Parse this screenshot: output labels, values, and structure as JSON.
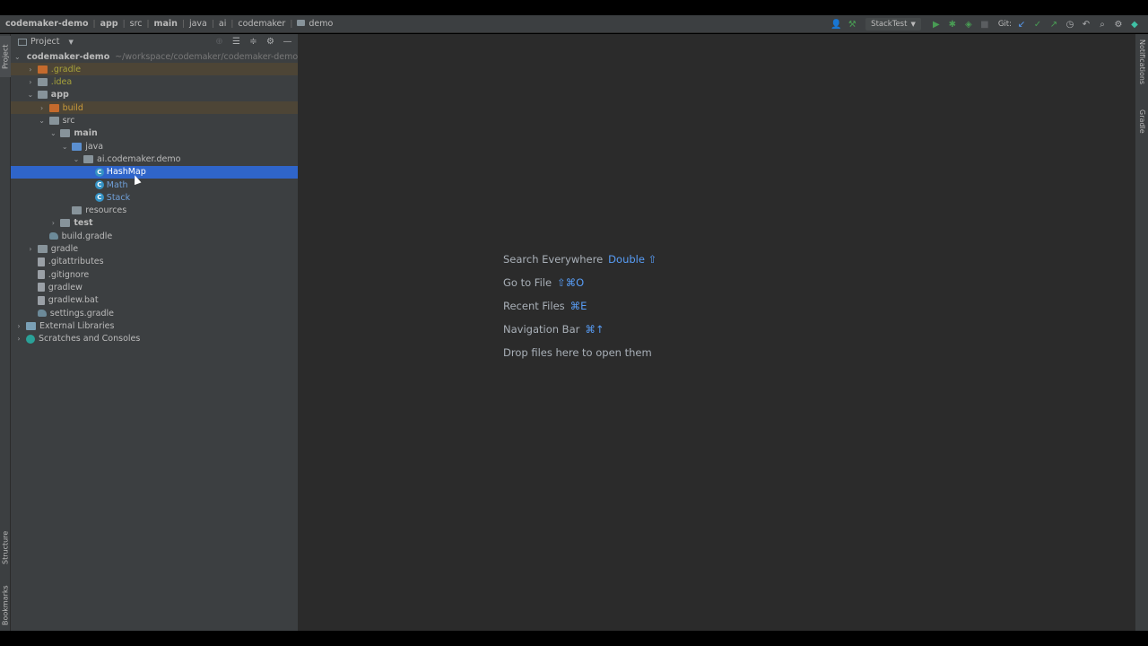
{
  "breadcrumbs": [
    {
      "label": "codemaker-demo",
      "bold": true
    },
    {
      "label": "app",
      "bold": true
    },
    {
      "label": "src",
      "bold": false
    },
    {
      "label": "main",
      "bold": true
    },
    {
      "label": "java",
      "bold": false
    },
    {
      "label": "ai",
      "bold": false
    },
    {
      "label": "codemaker",
      "bold": false
    },
    {
      "label": "demo",
      "bold": false,
      "folder": true
    }
  ],
  "toolbar": {
    "run_config": "StackTest",
    "git_label": "Git:"
  },
  "left_tabs": {
    "project": "Project",
    "structure": "Structure",
    "bookmarks": "Bookmarks"
  },
  "right_tabs": {
    "notifications": "Notifications",
    "gradle": "Gradle"
  },
  "project_panel": {
    "title": "Project"
  },
  "tree": [
    {
      "label": "codemaker-demo",
      "path": "~/workspace/codemaker/codemaker-demo",
      "indent": 0,
      "arrow": "open",
      "icon": "module",
      "style": "bold"
    },
    {
      "label": ".gradle",
      "indent": 1,
      "arrow": "closed",
      "icon": "folder-orange",
      "style": "y",
      "excluded": true
    },
    {
      "label": ".idea",
      "indent": 1,
      "arrow": "closed",
      "icon": "folder",
      "style": "y"
    },
    {
      "label": "app",
      "indent": 1,
      "arrow": "open",
      "icon": "folder",
      "style": "bold"
    },
    {
      "label": "build",
      "indent": 2,
      "arrow": "closed",
      "icon": "folder-orange",
      "style": "o",
      "excluded": true
    },
    {
      "label": "src",
      "indent": 2,
      "arrow": "open",
      "icon": "folder",
      "style": "w"
    },
    {
      "label": "main",
      "indent": 3,
      "arrow": "open",
      "icon": "folder",
      "style": "bold"
    },
    {
      "label": "java",
      "indent": 4,
      "arrow": "open",
      "icon": "folder-blue",
      "style": "w"
    },
    {
      "label": "ai.codemaker.demo",
      "indent": 5,
      "arrow": "open",
      "icon": "folder",
      "style": "w"
    },
    {
      "label": "HashMap",
      "indent": 6,
      "arrow": "none",
      "icon": "class",
      "style": "w",
      "selected": true
    },
    {
      "label": "Math",
      "indent": 6,
      "arrow": "none",
      "icon": "class",
      "style": "b"
    },
    {
      "label": "Stack",
      "indent": 6,
      "arrow": "none",
      "icon": "class",
      "style": "b"
    },
    {
      "label": "resources",
      "indent": 4,
      "arrow": "none",
      "icon": "folder",
      "style": "w"
    },
    {
      "label": "test",
      "indent": 3,
      "arrow": "closed",
      "icon": "folder",
      "style": "bold"
    },
    {
      "label": "build.gradle",
      "indent": 2,
      "arrow": "none",
      "icon": "gradle",
      "style": "w"
    },
    {
      "label": "gradle",
      "indent": 1,
      "arrow": "closed",
      "icon": "folder",
      "style": "w"
    },
    {
      "label": ".gitattributes",
      "indent": 1,
      "arrow": "none",
      "icon": "file",
      "style": "w"
    },
    {
      "label": ".gitignore",
      "indent": 1,
      "arrow": "none",
      "icon": "file",
      "style": "w"
    },
    {
      "label": "gradlew",
      "indent": 1,
      "arrow": "none",
      "icon": "file",
      "style": "w"
    },
    {
      "label": "gradlew.bat",
      "indent": 1,
      "arrow": "none",
      "icon": "file",
      "style": "w"
    },
    {
      "label": "settings.gradle",
      "indent": 1,
      "arrow": "none",
      "icon": "gradle",
      "style": "w"
    },
    {
      "label": "External Libraries",
      "indent": 0,
      "arrow": "closed",
      "icon": "lib",
      "style": "w"
    },
    {
      "label": "Scratches and Consoles",
      "indent": 0,
      "arrow": "closed",
      "icon": "scratch",
      "style": "w"
    }
  ],
  "editor_hints": [
    {
      "label": "Search Everywhere",
      "key": "Double ⇧"
    },
    {
      "label": "Go to File",
      "key": "⇧⌘O"
    },
    {
      "label": "Recent Files",
      "key": "⌘E"
    },
    {
      "label": "Navigation Bar",
      "key": "⌘↑"
    },
    {
      "label": "Drop files here to open them",
      "key": ""
    }
  ],
  "colors": {
    "selection": "#2f65ca",
    "key_hint": "#589df6",
    "panel_bg": "#3c3f41",
    "editor_bg": "#2b2b2b"
  }
}
